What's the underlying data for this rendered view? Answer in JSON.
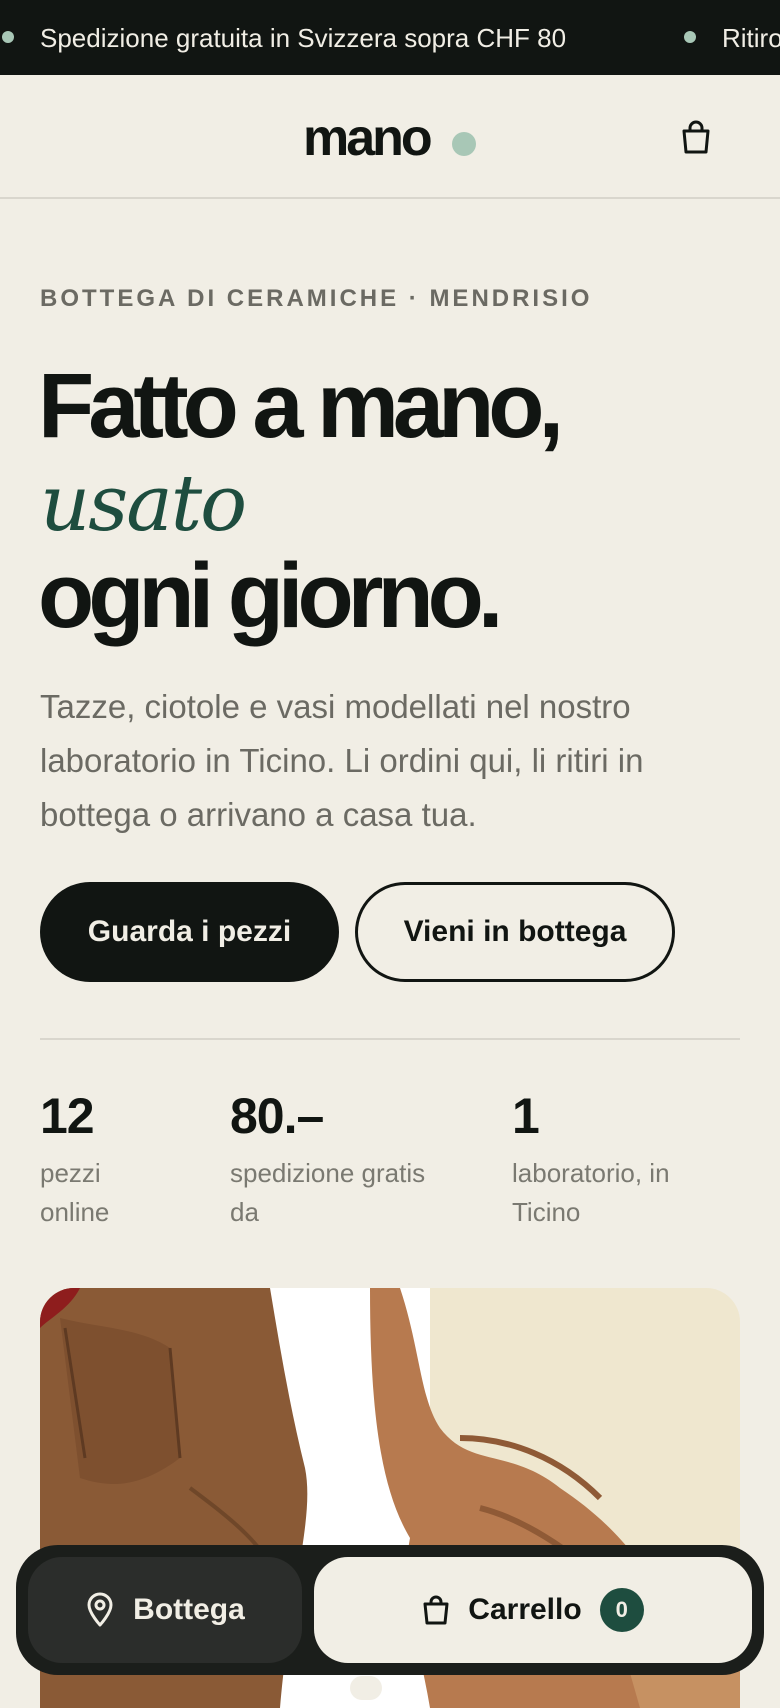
{
  "announcement": {
    "items": [
      "Spedizione gratuita in Svizzera sopra CHF 80",
      "Ritiro"
    ]
  },
  "header": {
    "logo": "mano",
    "cart_icon": "bag-icon"
  },
  "hero": {
    "kicker": "BOTTEGA DI CERAMICHE · MENDRISIO",
    "title_line1": "Fatto a mano,",
    "title_line2": "usato",
    "title_line3": "ogni giorno.",
    "lead": "Tazze, ciotole e vasi modellati nel nostro laboratorio in Ticino. Li ordini qui, li ritiri in bottega o arrivano a casa tua.",
    "primary_cta": "Guarda i pezzi",
    "secondary_cta": "Vieni in bottega"
  },
  "stats": [
    {
      "value": "12",
      "label_l1": "pezzi",
      "label_l2": "online"
    },
    {
      "value": "80.–",
      "label_l1": "spedizione gratis",
      "label_l2": "da"
    },
    {
      "value": "1",
      "label_l1": "laboratorio, in",
      "label_l2": "Ticino"
    }
  ],
  "bottom_bar": {
    "bottega_label": "Bottega",
    "bottega_icon": "map-pin-icon",
    "cart_label": "Carrello",
    "cart_icon": "bag-icon",
    "cart_count": "0"
  },
  "colors": {
    "background": "#f1eee5",
    "ink": "#111512",
    "accent_green": "#1e4d3f",
    "sage": "#a8c7b6"
  }
}
